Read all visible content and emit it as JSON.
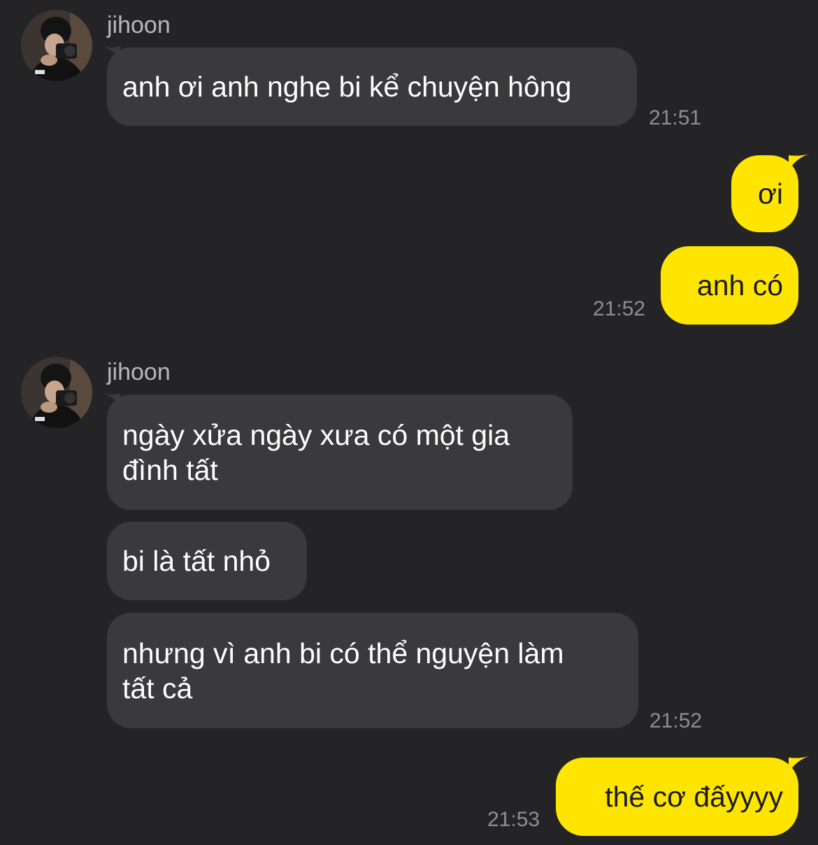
{
  "theme": {
    "background": "#242426",
    "incoming_bubble": "#3a3a3c",
    "outgoing_bubble": "#fee500",
    "timestamp_color": "#8e8e92"
  },
  "groups": [
    {
      "sender": "jihoon",
      "avatar_icon": "profile-photo-camera",
      "messages": [
        "anh ơi anh nghe bi kể chuyện hông"
      ],
      "time": "21:51"
    },
    {
      "sender": "me",
      "messages": [
        "ơi",
        "anh có"
      ],
      "time": "21:52"
    },
    {
      "sender": "jihoon",
      "avatar_icon": "profile-photo-camera",
      "messages": [
        "ngày xửa ngày xưa có một gia\nđình tất",
        "bi là tất nhỏ",
        "nhưng vì anh bi có thể nguyện làm\ntất cả"
      ],
      "time": "21:52"
    },
    {
      "sender": "me",
      "messages": [
        "thế cơ đấyyyy"
      ],
      "time": "21:53"
    }
  ]
}
